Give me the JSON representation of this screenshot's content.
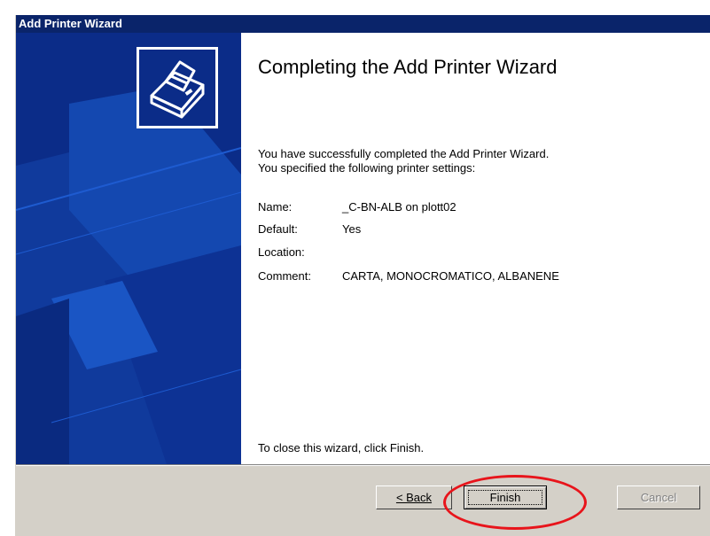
{
  "window": {
    "title": "Add Printer Wizard"
  },
  "content": {
    "heading": "Completing the Add Printer Wizard",
    "intro_line1": "You have successfully completed the Add Printer Wizard.",
    "intro_line2": "You specified the following printer settings:",
    "settings": [
      {
        "label": "Name:",
        "value": "_C-BN-ALB on plott02"
      },
      {
        "label": "Default:",
        "value": "Yes"
      },
      {
        "label": "Location:",
        "value": ""
      },
      {
        "label": "Comment:",
        "value": "CARTA, MONOCROMATICO, ALBANENE"
      }
    ],
    "closing": "To close this wizard, click Finish."
  },
  "buttons": {
    "back": "< Back",
    "finish": "Finish",
    "cancel": "Cancel"
  },
  "icons": {
    "wizard_graphic": "printer-icon"
  },
  "colors": {
    "titlebar": "#0a246a",
    "side_panel": "#0b2c88",
    "highlight_ring": "#e8141b",
    "button_face": "#d4d0c8"
  }
}
